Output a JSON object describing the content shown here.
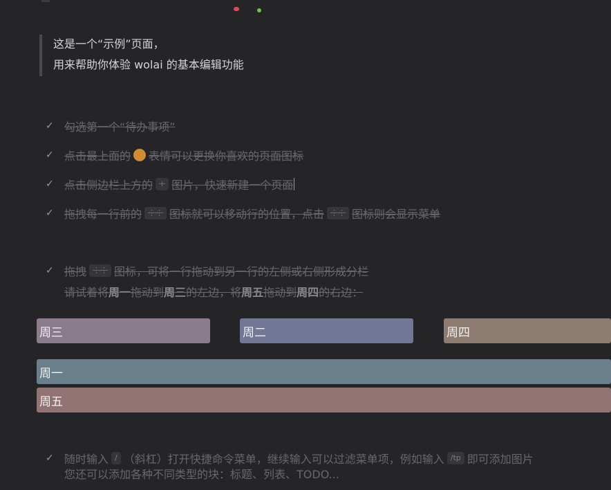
{
  "quote": {
    "line1": "这是一个“示例”页面，",
    "line2": "用来帮助你体验 wolai 的基本编辑功能"
  },
  "todos": [
    {
      "text": "勾选第一个“待办事项”",
      "checked": true
    },
    {
      "before": "点击最上面的",
      "after": "表情可以更换你喜欢的页面图标",
      "checked": true
    },
    {
      "before": "点击侧边栏上方的",
      "chip": "+",
      "after": "图片，快速新建一个页面",
      "checked": true
    },
    {
      "before": "拖拽每一行前的",
      "chip1": "⋮⋮",
      "middle": "图标就可以移动行的位置，点击",
      "chip2": "⋮⋮",
      "after": "图标则会显示菜单",
      "checked": true
    },
    {
      "before": "拖拽",
      "chip": "⋮⋮",
      "after": "图标，可将一行拖动到另一行的左侧或右侧形成分栏",
      "checked": true
    }
  ],
  "sub_line": {
    "p1": "请试着将",
    "b1": "周一",
    "p2": "拖动到",
    "b2": "周三",
    "p3": "的左边，将",
    "b3": "周五",
    "p4": "拖动到",
    "b4": "周四",
    "p5": "的右边："
  },
  "blocks": [
    {
      "label": "周三",
      "color": "#8a7c8c"
    },
    {
      "label": "周二",
      "color": "#727796"
    },
    {
      "label": "周四",
      "color": "#8e7c70"
    },
    {
      "label": "周一",
      "color": "#6a7f8c"
    },
    {
      "label": "周五",
      "color": "#917373"
    }
  ],
  "bottom_todo": {
    "p1": "随时输入",
    "chip1": "/",
    "p2": "（斜杠）打开快捷命令菜单，继续输入可以过滤菜单项，例如输入",
    "chip2": "/tp",
    "p3": "即可添加图片",
    "line2": "您还可以添加各种不同类型的块：标题、列表、TODO..."
  },
  "icons": {
    "check": "checkmark-icon",
    "drag": "drag-handle-icon",
    "emoji": "page-emoji-icon"
  }
}
